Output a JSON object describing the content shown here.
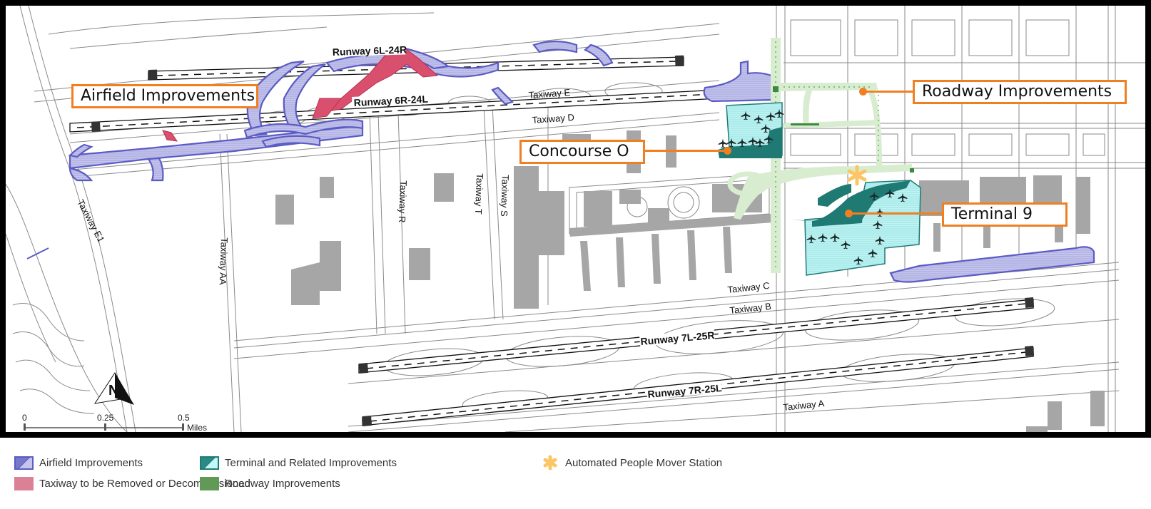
{
  "map": {
    "callouts": {
      "airfield": "Airfield Improvements",
      "roadway": "Roadway Improvements",
      "concourse": "Concourse O",
      "terminal": "Terminal 9"
    },
    "runways": [
      {
        "id": "6L-24R",
        "label": "Runway 6L-24R"
      },
      {
        "id": "6R-24L",
        "label": "Runway 6R-24L"
      },
      {
        "id": "7L-25R",
        "label": "Runway 7L-25R"
      },
      {
        "id": "7R-25L",
        "label": "Runway 7R-25L"
      }
    ],
    "taxiways": {
      "e": "Taxiway E",
      "d": "Taxiway D",
      "e1": "Taxiway E1",
      "aa": "Taxiway AA",
      "r": "Taxiway R",
      "t": "Taxiway T",
      "s": "Taxiway S",
      "c": "Taxiway C",
      "b": "Taxiway B",
      "a": "Taxiway A"
    },
    "north_arrow": "N",
    "scale_bar": {
      "ticks": [
        "0",
        "0.25",
        "0.5"
      ],
      "unit": "Miles"
    },
    "colors": {
      "airfield_fill": "#b9b9e6",
      "airfield_stroke": "#5b5bc4",
      "removed_fill": "#d8506e",
      "terminal_dark": "#1f7a74",
      "terminal_light": "#b8f0f0",
      "roadway_light": "#d8ecd0",
      "roadway_dark": "#3c8a3c",
      "apm_station": "#fcc566",
      "callout_orange": "#f07f22",
      "basemap_line": "#8a8a8a",
      "basemap_building": "#a6a6a6"
    }
  },
  "legend": {
    "items": [
      {
        "id": "airfield",
        "label": "Airfield Improvements"
      },
      {
        "id": "taxiway_removed",
        "label": "Taxiway to be Removed or Decommissioned"
      },
      {
        "id": "terminal",
        "label": "Terminal and Related Improvements"
      },
      {
        "id": "roadway",
        "label": "Roadway Improvements"
      },
      {
        "id": "apm",
        "label": "Automated People Mover Station"
      }
    ]
  }
}
